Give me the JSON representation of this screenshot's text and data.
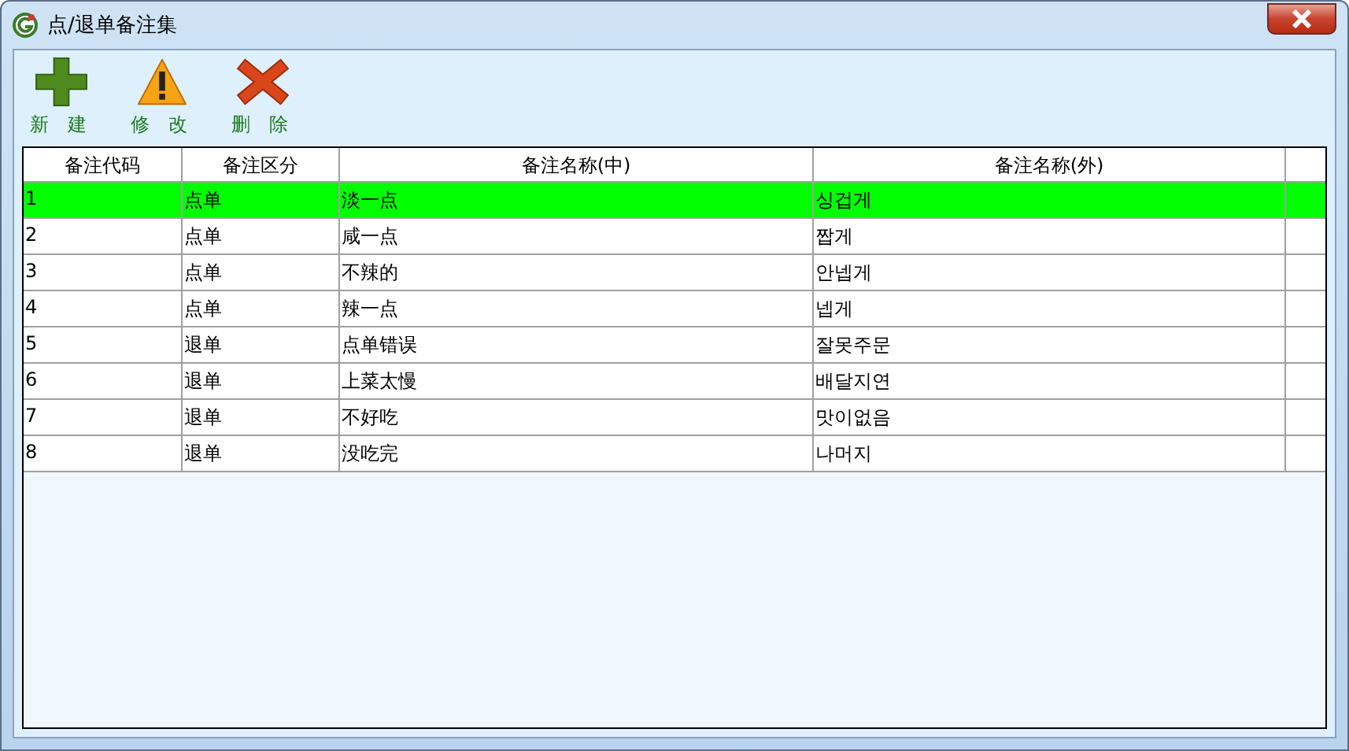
{
  "window": {
    "title": "点/退单备注集"
  },
  "toolbar": [
    {
      "kind": "add",
      "label": "新 建"
    },
    {
      "kind": "warning",
      "label": "修 改"
    },
    {
      "kind": "delete",
      "label": "删 除"
    }
  ],
  "table": {
    "columns": [
      "备注代码",
      "备注区分",
      "备注名称(中)",
      "备注名称(外)"
    ],
    "rows": [
      {
        "cells": [
          "1",
          "点单",
          "淡一点",
          "싱겁게"
        ],
        "selected": true
      },
      {
        "cells": [
          "2",
          "点单",
          "咸一点",
          "짭게"
        ],
        "selected": false
      },
      {
        "cells": [
          "3",
          "点单",
          "不辣的",
          "안넵게"
        ],
        "selected": false
      },
      {
        "cells": [
          "4",
          "点单",
          "辣一点",
          "넵게"
        ],
        "selected": false
      },
      {
        "cells": [
          "5",
          "退单",
          "点单错误",
          "잘못주문"
        ],
        "selected": false
      },
      {
        "cells": [
          "6",
          "退单",
          "上菜太慢",
          "배달지연"
        ],
        "selected": false
      },
      {
        "cells": [
          "7",
          "退单",
          "不好吃",
          "맛이없음"
        ],
        "selected": false
      },
      {
        "cells": [
          "8",
          "退单",
          "没吃完",
          "나머지"
        ],
        "selected": false
      }
    ]
  }
}
